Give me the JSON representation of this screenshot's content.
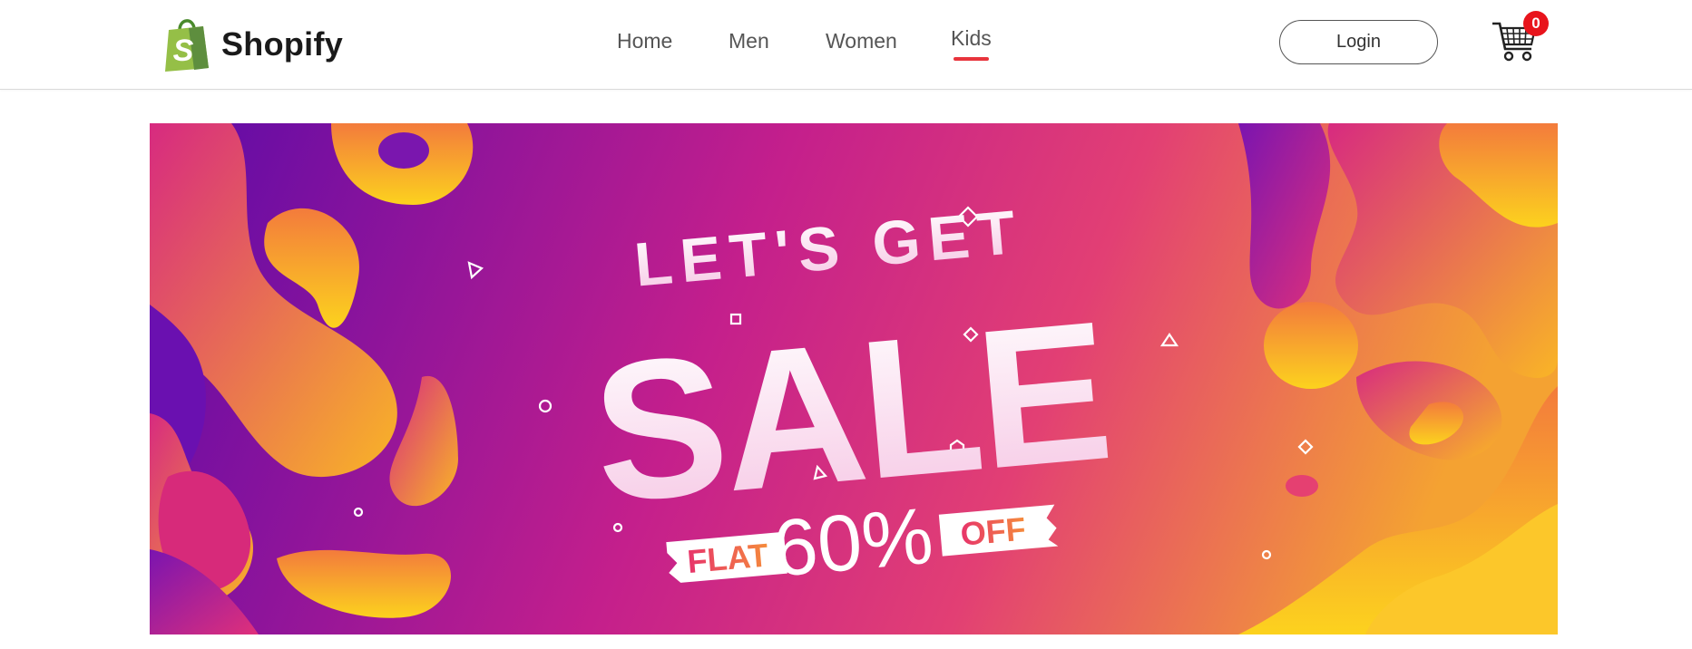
{
  "brand": {
    "name": "Shopify",
    "logo_letter": "S",
    "logo_color": "#5a9e3a"
  },
  "nav": {
    "items": [
      {
        "label": "Home",
        "active": false
      },
      {
        "label": "Men",
        "active": false
      },
      {
        "label": "Women",
        "active": false
      },
      {
        "label": "Kids",
        "active": true
      }
    ],
    "active_color": "#e8343c"
  },
  "header": {
    "login_label": "Login",
    "cart_count": "0",
    "cart_badge_color": "#e8141c"
  },
  "banner": {
    "line1": "LET'S GET",
    "headline": "SALE",
    "tag_left": "FLAT",
    "discount": "60%",
    "tag_right": "OFF",
    "colors": {
      "purple": "#5b0aa8",
      "magenta": "#d6267a",
      "orange": "#f08a3a",
      "yellow": "#fcd21e"
    }
  }
}
